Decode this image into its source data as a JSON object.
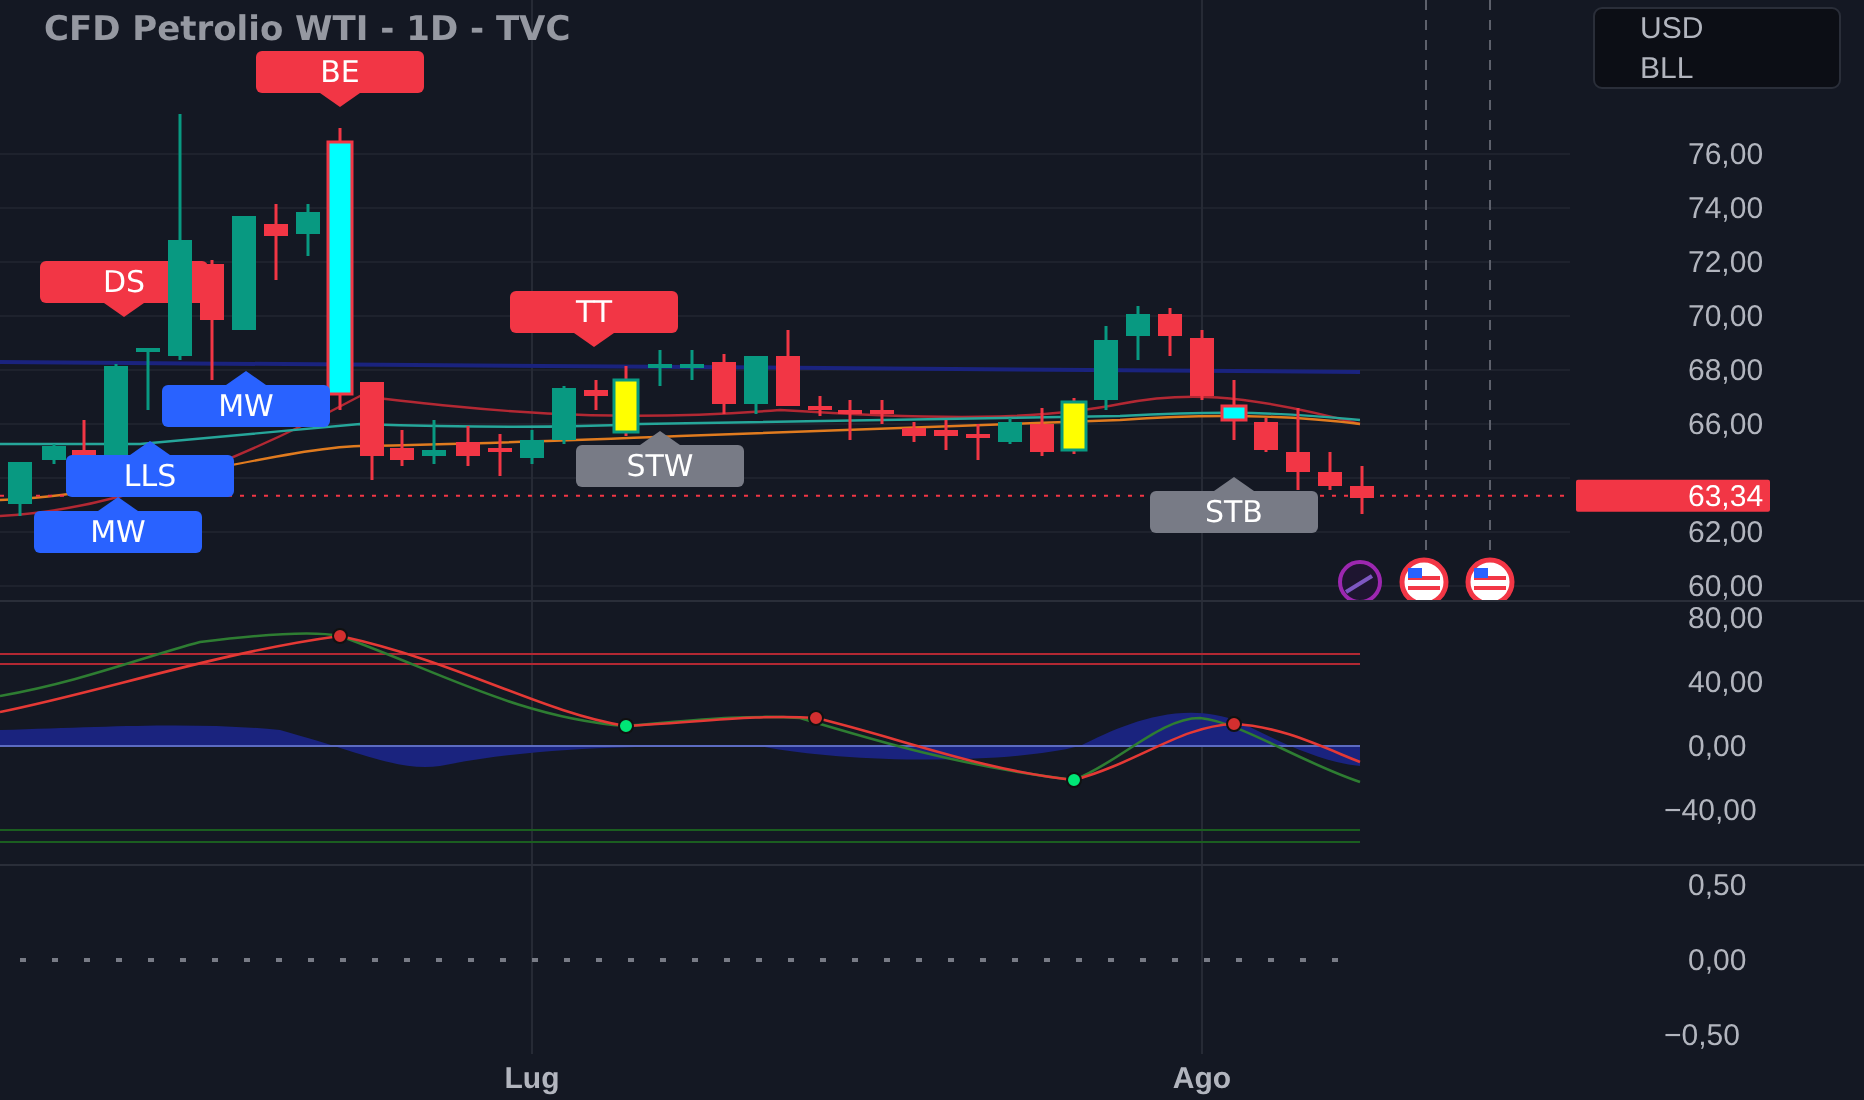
{
  "title": "CFD Petrolio WTI - 1D - TVC",
  "currency": {
    "lines": [
      "USD",
      "BLL"
    ]
  },
  "price_axis": {
    "ticks": [
      "76,00",
      "74,00",
      "72,00",
      "70,00",
      "68,00",
      "66,00",
      "62,00",
      "60,00"
    ]
  },
  "last_price": {
    "label": "63,34"
  },
  "signals": [
    {
      "label": "BE",
      "kind": "bearish"
    },
    {
      "label": "DS",
      "kind": "bearish"
    },
    {
      "label": "TT",
      "kind": "bearish"
    },
    {
      "label": "MW",
      "kind": "bullish"
    },
    {
      "label": "LLS",
      "kind": "bullish"
    },
    {
      "label": "MW",
      "kind": "bullish"
    },
    {
      "label": "STW",
      "kind": "neutral"
    },
    {
      "label": "STB",
      "kind": "neutral"
    }
  ],
  "oscillator": {
    "ticks": [
      "80,00",
      "40,00",
      "0,00",
      "−40,00"
    ]
  },
  "lower_pane": {
    "ticks": [
      "0,50",
      "0,00",
      "−0,50"
    ]
  },
  "time_axis": {
    "labels": [
      "Lug",
      "Ago"
    ]
  }
}
